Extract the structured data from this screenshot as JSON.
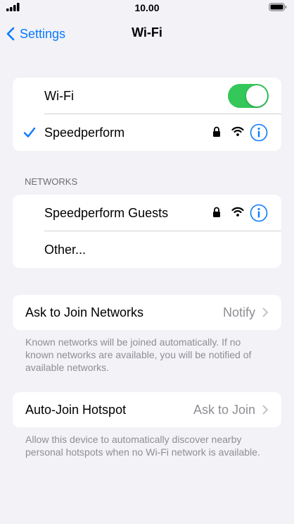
{
  "status_bar": {
    "time": "10.00"
  },
  "nav": {
    "back_label": "Settings",
    "title": "Wi-Fi"
  },
  "wifi_card": {
    "toggle_label": "Wi-Fi",
    "toggle_on": true,
    "current_network": "Speedperform"
  },
  "networks": {
    "header": "NETWORKS",
    "items": [
      {
        "name": "Speedperform Guests"
      },
      {
        "name": "Other..."
      }
    ]
  },
  "ask_to_join": {
    "label": "Ask to Join Networks",
    "value": "Notify",
    "footnote": "Known networks will be joined automatically. If no known networks are available, you will be notified of available networks."
  },
  "auto_join": {
    "label": "Auto-Join Hotspot",
    "value": "Ask to Join",
    "footnote": "Allow this device to automatically discover nearby personal hotspots when no Wi-Fi network is available."
  },
  "colors": {
    "accent": "#0a7aff",
    "toggle_on": "#34c759",
    "background": "#f2f2f7",
    "secondary_text": "#8e8e93"
  },
  "icons": [
    "signal-icon",
    "battery-icon",
    "chevron-left-icon",
    "checkmark-icon",
    "lock-icon",
    "wifi-icon",
    "info-icon",
    "chevron-right-icon"
  ]
}
